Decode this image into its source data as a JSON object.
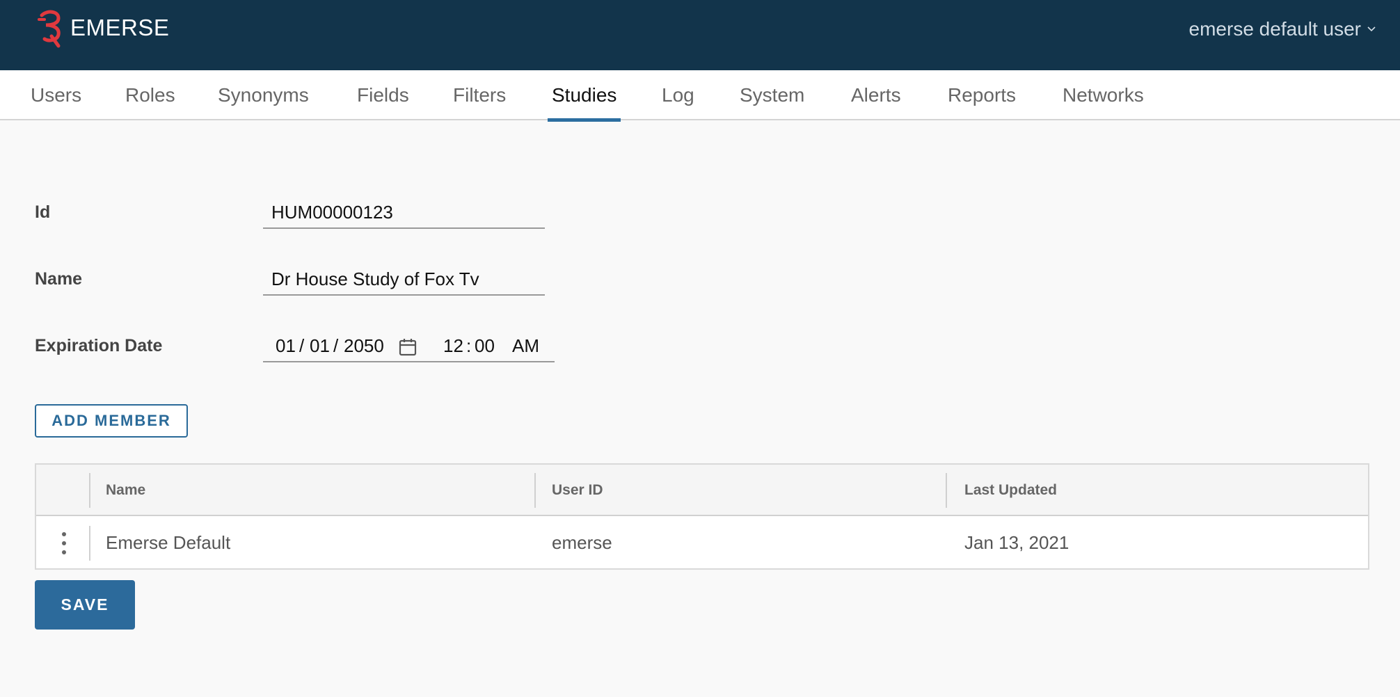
{
  "header": {
    "app_title": "EMERSE",
    "user_menu_label": "emerse default user"
  },
  "tabs": [
    {
      "label": "Users"
    },
    {
      "label": "Roles"
    },
    {
      "label": "Synonyms"
    },
    {
      "label": "Fields"
    },
    {
      "label": "Filters"
    },
    {
      "label": "Studies",
      "active": true
    },
    {
      "label": "Log"
    },
    {
      "label": "System"
    },
    {
      "label": "Alerts"
    },
    {
      "label": "Reports"
    },
    {
      "label": "Networks"
    }
  ],
  "form": {
    "id_label": "Id",
    "id_value": "HUM00000123",
    "name_label": "Name",
    "name_value": "Dr House Study of Fox Tv",
    "expiration_label": "Expiration Date",
    "expiration_date": {
      "month": "01",
      "day": "01",
      "year": "2050",
      "hour": "12",
      "minute": "00",
      "ampm": "AM",
      "date_sep": "/",
      "time_sep": ":"
    }
  },
  "add_member_label": "ADD MEMBER",
  "table": {
    "columns": [
      "Name",
      "User ID",
      "Last Updated"
    ],
    "rows": [
      {
        "name": "Emerse Default",
        "user_id": "emerse",
        "last_updated": "Jan 13, 2021"
      }
    ]
  },
  "save_label": "SAVE",
  "colors": {
    "header_bg": "#12344b",
    "accent": "#2c6a9b",
    "logo": "#e0393e"
  },
  "icons": {
    "logo": "emerse-logo-icon",
    "user_menu": "chevron-down-icon",
    "date_picker": "calendar-icon",
    "row_menu": "vertical-dots-icon"
  }
}
